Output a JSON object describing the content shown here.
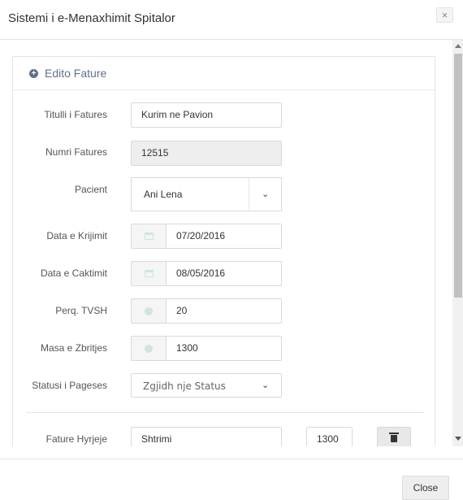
{
  "modal": {
    "title": "Sistemi i e-Menaxhimit Spitalor",
    "close_x": "×",
    "close_button": "Close"
  },
  "panel": {
    "title": "Edito Fature"
  },
  "form": {
    "titulli": {
      "label": "Titulli i Fatures",
      "value": "Kurim ne Pavion"
    },
    "numri": {
      "label": "Numri Fatures",
      "value": "12515"
    },
    "pacient": {
      "label": "Pacient",
      "value": "Ani Lena"
    },
    "data_krijimit": {
      "label": "Data e Krijimit",
      "value": "07/20/2016"
    },
    "data_caktimit": {
      "label": "Data e Caktimit",
      "value": "08/05/2016"
    },
    "perq_tvsh": {
      "label": "Perq. TVSH",
      "value": "20"
    },
    "masa_zbritjes": {
      "label": "Masa e Zbritjes",
      "value": "1300"
    },
    "statusi": {
      "label": "Statusi i Pageses",
      "placeholder": "Zgjidh nje Status"
    },
    "fature_hyrjeje": {
      "label": "Fature Hyrjeje",
      "item": "Shtrimi",
      "amount": "1300"
    }
  },
  "icons": {
    "calendar": "calendar-icon",
    "percent": "circle-icon",
    "trash": "trash-icon",
    "plus": "plus-circle-icon",
    "chevron": "chevron-down-icon"
  },
  "colors": {
    "panel_title": "#60708a",
    "addon_icon": "#cfe6d8",
    "disabled_bg": "#eeeeee"
  }
}
